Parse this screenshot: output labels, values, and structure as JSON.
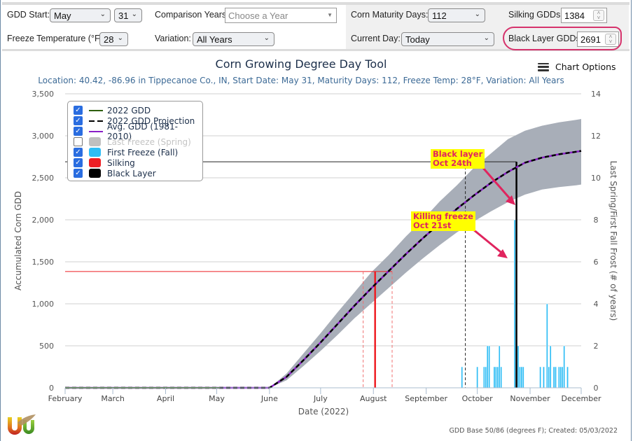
{
  "controls": {
    "gdd_start_label": "GDD Start:",
    "gdd_start_month": "May",
    "gdd_start_day": "31",
    "comparison_years_label": "Comparison Years:",
    "comparison_years_placeholder": "Choose a Year",
    "corn_maturity_label": "Corn Maturity Days:",
    "corn_maturity_value": "112",
    "silking_label": "Silking GDDs:",
    "silking_value": "1384",
    "freeze_temp_label": "Freeze Temperature (°F):",
    "freeze_temp_value": "28",
    "variation_label": "Variation:",
    "variation_value": "All Years",
    "current_day_label": "Current Day:",
    "current_day_value": "Today",
    "black_layer_label": "Black Layer GDDs:",
    "black_layer_value": "2691",
    "chart_options_label": "Chart Options",
    "highlight_color": "#d6336c"
  },
  "legend": [
    {
      "label": "2022 GDD",
      "checked": true,
      "color": "#2e5e0e"
    },
    {
      "label": "2022 GDD Projection",
      "checked": true,
      "color": "#000000"
    },
    {
      "label": "Avg. GDD (1981-2010)",
      "checked": true,
      "color": "#8a1fc7"
    },
    {
      "label": "Last Freeze (Spring)",
      "checked": false,
      "color": "#c0c0c0"
    },
    {
      "label": "First Freeze (Fall)",
      "checked": true,
      "color": "#2ebdf5"
    },
    {
      "label": "Silking",
      "checked": true,
      "color": "#ee1d23"
    },
    {
      "label": "Black Layer",
      "checked": true,
      "color": "#000000"
    }
  ],
  "annotations": [
    {
      "line1": "Black layer",
      "line2": "Oct 24th"
    },
    {
      "line1": "Killing freeze",
      "line2": "Oct 21st"
    }
  ],
  "footer": "GDD Base 50/86 (degrees F); Created: 05/03/2022",
  "chart_data": {
    "type": "line",
    "title": "Corn Growing Degree Day Tool",
    "subtitle": "Location: 40.42, -86.96 in Tippecanoe Co., IN, Start Date: May 31, Maturity Days: 112, Freeze Temp: 28°F, Variation: All Years",
    "xlabel": "Date (2022)",
    "ylabel": "Accumulated Corn GDD",
    "y2label": "Last Spring/First Fall Frost (# of years)",
    "x_ticks": [
      "February",
      "March",
      "April",
      "May",
      "June",
      "July",
      "August",
      "September",
      "October",
      "November",
      "December"
    ],
    "x_range_days": [
      0,
      303
    ],
    "ylim": [
      0,
      3500
    ],
    "y_ticks": [
      "0",
      "500",
      "1,000",
      "1,500",
      "2,000",
      "2,500",
      "3,000",
      "3,500"
    ],
    "y2lim": [
      0,
      14
    ],
    "y2_ticks": [
      "0",
      "2",
      "4",
      "6",
      "8",
      "10",
      "12",
      "14"
    ],
    "grid": true,
    "legend_position": "top-left",
    "x_day_note": "x values are days since Feb 1",
    "avg_gdd": {
      "x": [
        0,
        120,
        130,
        140,
        150,
        160,
        170,
        180,
        190,
        200,
        210,
        220,
        230,
        240,
        250,
        260,
        270,
        280,
        290,
        300,
        303
      ],
      "y": [
        0,
        0,
        130,
        330,
        540,
        760,
        980,
        1190,
        1390,
        1590,
        1780,
        1960,
        2130,
        2290,
        2440,
        2570,
        2680,
        2740,
        2780,
        2810,
        2820
      ]
    },
    "gdd_2022": {
      "x": [
        0,
        91
      ],
      "y": [
        0,
        0
      ]
    },
    "range_band": {
      "x": [
        0,
        120,
        130,
        140,
        150,
        160,
        170,
        180,
        190,
        200,
        210,
        220,
        230,
        240,
        250,
        260,
        270,
        280,
        290,
        300,
        303
      ],
      "low": [
        0,
        0,
        90,
        260,
        440,
        630,
        830,
        1010,
        1190,
        1370,
        1540,
        1700,
        1850,
        1980,
        2100,
        2210,
        2300,
        2360,
        2390,
        2410,
        2420
      ],
      "high": [
        0,
        0,
        170,
        410,
        650,
        900,
        1140,
        1380,
        1580,
        1800,
        2000,
        2220,
        2410,
        2620,
        2790,
        2960,
        3060,
        3120,
        3160,
        3190,
        3200
      ]
    },
    "silking": {
      "x": 182,
      "gdd": 1384,
      "range_x": [
        175,
        192
      ]
    },
    "black_layer": {
      "x": 265,
      "gdd": 2691,
      "current_day_x": 235
    },
    "first_freeze_bars": {
      "x": [
        233,
        242,
        246,
        247,
        248,
        249,
        252,
        253,
        254,
        255,
        256,
        264,
        265,
        266,
        267,
        268,
        269,
        279,
        281,
        283,
        284,
        285,
        287,
        288,
        290,
        291,
        292,
        293,
        295
      ],
      "counts": [
        1,
        1,
        1,
        1,
        2,
        2,
        1,
        1,
        1,
        2,
        1,
        8,
        3,
        2,
        1,
        1,
        1,
        1,
        1,
        4,
        1,
        2,
        1,
        1,
        1,
        1,
        1,
        2,
        1
      ]
    }
  }
}
